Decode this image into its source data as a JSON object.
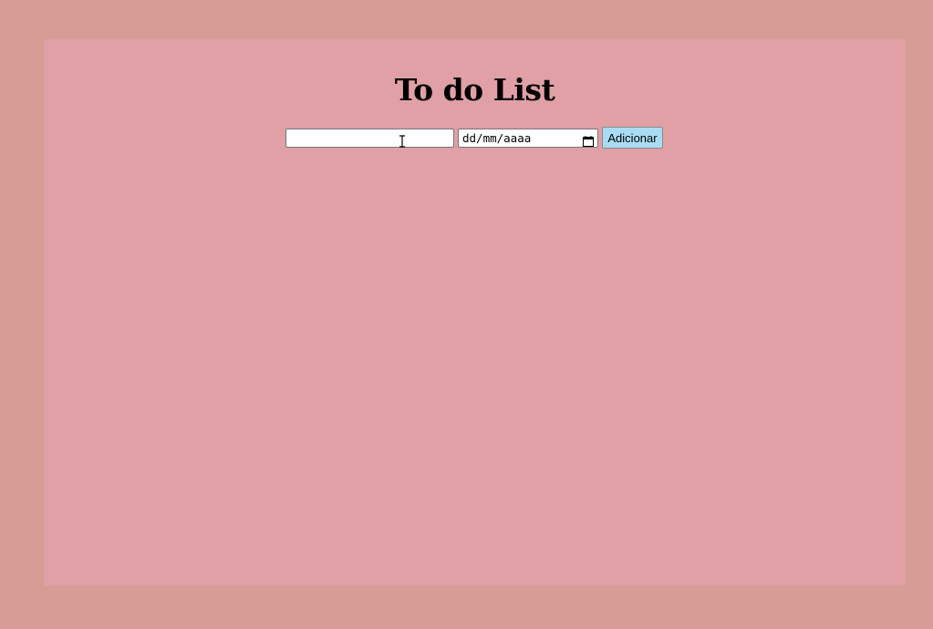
{
  "page": {
    "title": "To do List"
  },
  "form": {
    "task_value": "",
    "task_placeholder": "",
    "date_placeholder": "dd/mm/aaaa",
    "add_label": "Adicionar"
  },
  "icons": {
    "calendar": "calendar-icon",
    "cursor": "text-cursor-icon"
  },
  "colors": {
    "outer_background": "#d89c96",
    "panel_background": "#e0a0a6",
    "button_background": "#a9dcf2"
  },
  "tasks": []
}
